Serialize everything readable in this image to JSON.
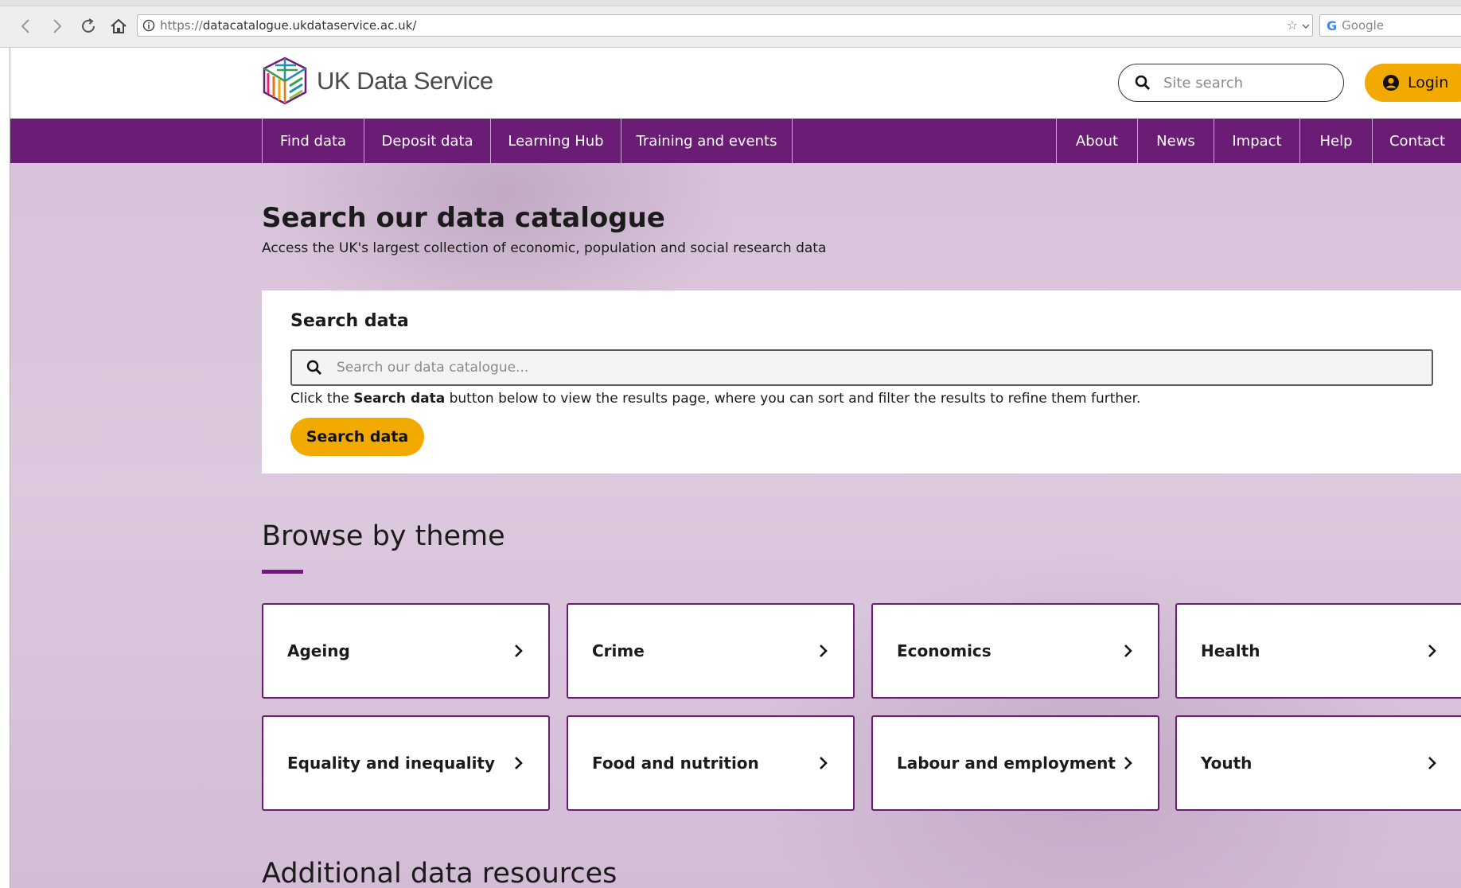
{
  "browser": {
    "url_protocol": "https://",
    "url_rest": "datacatalogue.ukdataservice.ac.uk/",
    "search_engine": "Google"
  },
  "header": {
    "logo_text": "UK Data Service",
    "site_search_placeholder": "Site search",
    "login_label": "Login"
  },
  "nav": {
    "left": [
      "Find data",
      "Deposit data",
      "Learning Hub",
      "Training and events"
    ],
    "right": [
      "About",
      "News",
      "Impact",
      "Help",
      "Contact"
    ]
  },
  "hero": {
    "title": "Search our data catalogue",
    "subtitle": "Access the UK's largest collection of economic, population and social research data"
  },
  "search_card": {
    "title": "Search data",
    "placeholder": "Search our data catalogue...",
    "hint_before": "Click the ",
    "hint_bold": "Search data",
    "hint_after": " button below to view the results page, where you can sort and filter the results to refine them further.",
    "button_label": "Search data"
  },
  "browse": {
    "title": "Browse by theme",
    "themes": [
      "Ageing",
      "Crime",
      "Economics",
      "Health",
      "Equality and inequality",
      "Food and nutrition",
      "Labour and employment",
      "Youth"
    ]
  },
  "additional": {
    "title": "Additional data resources"
  },
  "colors": {
    "brand_purple": "#6b1c74",
    "accent_yellow": "#f2a900",
    "hero_background": "#dcc8dd"
  }
}
